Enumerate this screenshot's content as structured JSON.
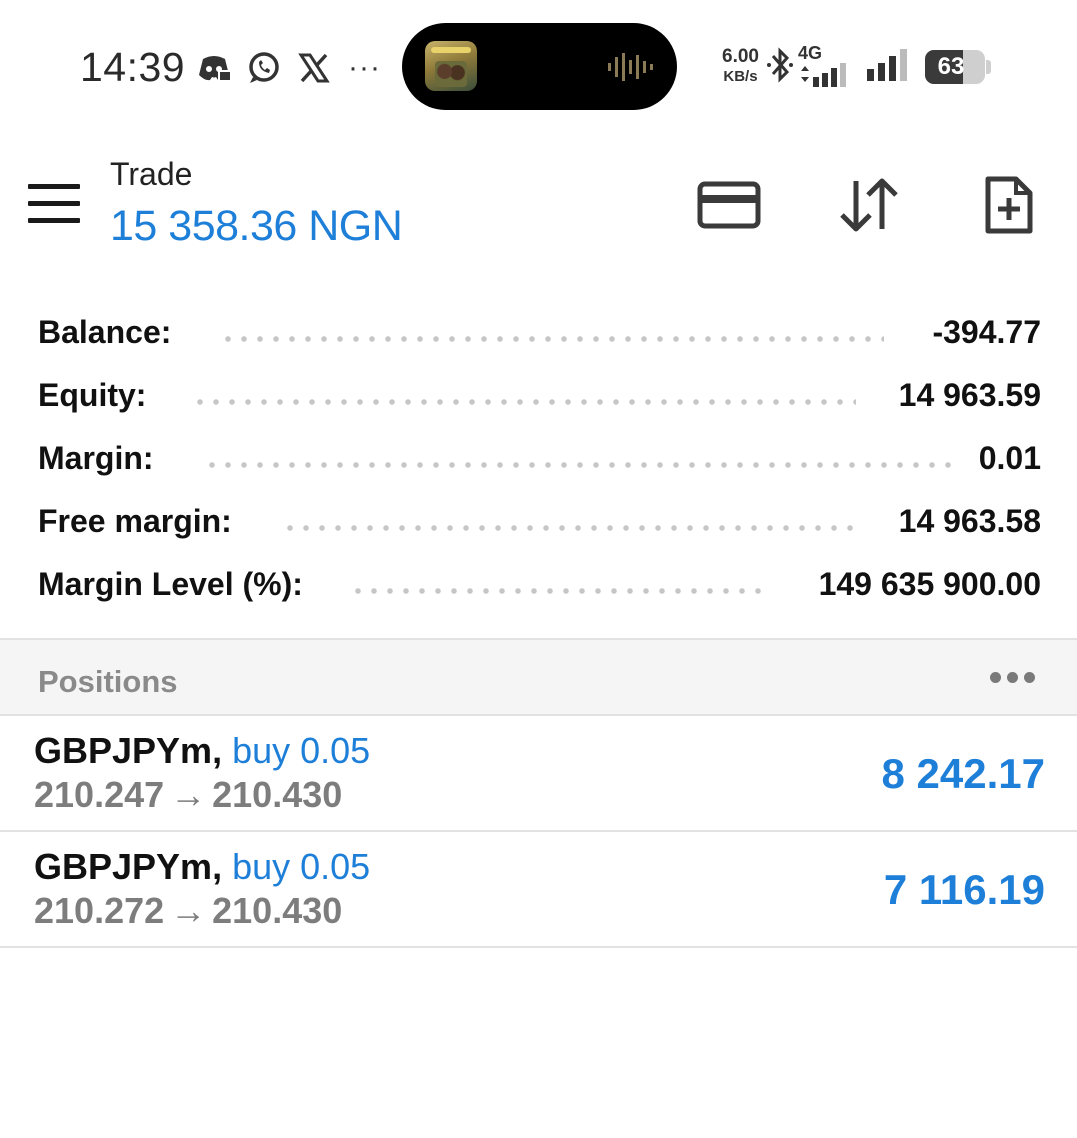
{
  "status_bar": {
    "time": "14:39",
    "app_icons": [
      "discord-icon",
      "whatsapp-icon",
      "x-icon"
    ],
    "more": "···",
    "net_speed_value": "6.00",
    "net_speed_unit": "KB/s",
    "network_type": "4G",
    "battery_level": "63",
    "battery_fraction": 0.63
  },
  "header": {
    "title": "Trade",
    "balance": "15 358.36 NGN",
    "icons": [
      "card-icon",
      "sort-arrows-icon",
      "new-document-icon"
    ]
  },
  "summary": {
    "rows": [
      {
        "label": "Balance:",
        "value": "-394.77"
      },
      {
        "label": "Equity:",
        "value": "14 963.59"
      },
      {
        "label": "Margin:",
        "value": "0.01"
      },
      {
        "label": "Free margin:",
        "value": "14 963.58"
      },
      {
        "label": "Margin Level (%):",
        "value": "149 635 900.00"
      }
    ]
  },
  "positions": {
    "title": "Positions",
    "items": [
      {
        "symbol": "GBPJPYm,",
        "type": "buy 0.05",
        "open_price": "210.247",
        "arrow": "→",
        "current_price": "210.430",
        "profit": "8 242.17"
      },
      {
        "symbol": "GBPJPYm,",
        "type": "buy 0.05",
        "open_price": "210.272",
        "arrow": "→",
        "current_price": "210.430",
        "profit": "7 116.19"
      }
    ]
  },
  "colors": {
    "accent": "#1e7fd9",
    "text": "#111111",
    "muted": "#7d7d7d",
    "divider": "#e2e2e2",
    "section_bg": "#f5f5f5"
  }
}
